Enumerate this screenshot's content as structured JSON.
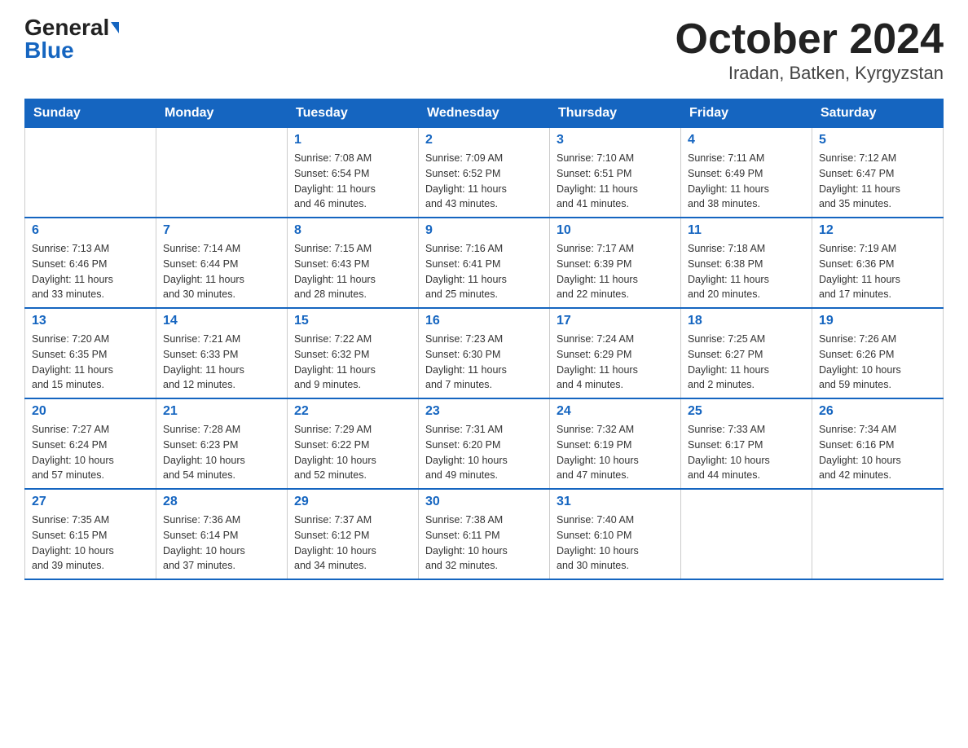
{
  "logo": {
    "general": "General",
    "blue": "Blue"
  },
  "title": "October 2024",
  "subtitle": "Iradan, Batken, Kyrgyzstan",
  "weekdays": [
    "Sunday",
    "Monday",
    "Tuesday",
    "Wednesday",
    "Thursday",
    "Friday",
    "Saturday"
  ],
  "weeks": [
    [
      {
        "day": "",
        "info": ""
      },
      {
        "day": "",
        "info": ""
      },
      {
        "day": "1",
        "info": "Sunrise: 7:08 AM\nSunset: 6:54 PM\nDaylight: 11 hours\nand 46 minutes."
      },
      {
        "day": "2",
        "info": "Sunrise: 7:09 AM\nSunset: 6:52 PM\nDaylight: 11 hours\nand 43 minutes."
      },
      {
        "day": "3",
        "info": "Sunrise: 7:10 AM\nSunset: 6:51 PM\nDaylight: 11 hours\nand 41 minutes."
      },
      {
        "day": "4",
        "info": "Sunrise: 7:11 AM\nSunset: 6:49 PM\nDaylight: 11 hours\nand 38 minutes."
      },
      {
        "day": "5",
        "info": "Sunrise: 7:12 AM\nSunset: 6:47 PM\nDaylight: 11 hours\nand 35 minutes."
      }
    ],
    [
      {
        "day": "6",
        "info": "Sunrise: 7:13 AM\nSunset: 6:46 PM\nDaylight: 11 hours\nand 33 minutes."
      },
      {
        "day": "7",
        "info": "Sunrise: 7:14 AM\nSunset: 6:44 PM\nDaylight: 11 hours\nand 30 minutes."
      },
      {
        "day": "8",
        "info": "Sunrise: 7:15 AM\nSunset: 6:43 PM\nDaylight: 11 hours\nand 28 minutes."
      },
      {
        "day": "9",
        "info": "Sunrise: 7:16 AM\nSunset: 6:41 PM\nDaylight: 11 hours\nand 25 minutes."
      },
      {
        "day": "10",
        "info": "Sunrise: 7:17 AM\nSunset: 6:39 PM\nDaylight: 11 hours\nand 22 minutes."
      },
      {
        "day": "11",
        "info": "Sunrise: 7:18 AM\nSunset: 6:38 PM\nDaylight: 11 hours\nand 20 minutes."
      },
      {
        "day": "12",
        "info": "Sunrise: 7:19 AM\nSunset: 6:36 PM\nDaylight: 11 hours\nand 17 minutes."
      }
    ],
    [
      {
        "day": "13",
        "info": "Sunrise: 7:20 AM\nSunset: 6:35 PM\nDaylight: 11 hours\nand 15 minutes."
      },
      {
        "day": "14",
        "info": "Sunrise: 7:21 AM\nSunset: 6:33 PM\nDaylight: 11 hours\nand 12 minutes."
      },
      {
        "day": "15",
        "info": "Sunrise: 7:22 AM\nSunset: 6:32 PM\nDaylight: 11 hours\nand 9 minutes."
      },
      {
        "day": "16",
        "info": "Sunrise: 7:23 AM\nSunset: 6:30 PM\nDaylight: 11 hours\nand 7 minutes."
      },
      {
        "day": "17",
        "info": "Sunrise: 7:24 AM\nSunset: 6:29 PM\nDaylight: 11 hours\nand 4 minutes."
      },
      {
        "day": "18",
        "info": "Sunrise: 7:25 AM\nSunset: 6:27 PM\nDaylight: 11 hours\nand 2 minutes."
      },
      {
        "day": "19",
        "info": "Sunrise: 7:26 AM\nSunset: 6:26 PM\nDaylight: 10 hours\nand 59 minutes."
      }
    ],
    [
      {
        "day": "20",
        "info": "Sunrise: 7:27 AM\nSunset: 6:24 PM\nDaylight: 10 hours\nand 57 minutes."
      },
      {
        "day": "21",
        "info": "Sunrise: 7:28 AM\nSunset: 6:23 PM\nDaylight: 10 hours\nand 54 minutes."
      },
      {
        "day": "22",
        "info": "Sunrise: 7:29 AM\nSunset: 6:22 PM\nDaylight: 10 hours\nand 52 minutes."
      },
      {
        "day": "23",
        "info": "Sunrise: 7:31 AM\nSunset: 6:20 PM\nDaylight: 10 hours\nand 49 minutes."
      },
      {
        "day": "24",
        "info": "Sunrise: 7:32 AM\nSunset: 6:19 PM\nDaylight: 10 hours\nand 47 minutes."
      },
      {
        "day": "25",
        "info": "Sunrise: 7:33 AM\nSunset: 6:17 PM\nDaylight: 10 hours\nand 44 minutes."
      },
      {
        "day": "26",
        "info": "Sunrise: 7:34 AM\nSunset: 6:16 PM\nDaylight: 10 hours\nand 42 minutes."
      }
    ],
    [
      {
        "day": "27",
        "info": "Sunrise: 7:35 AM\nSunset: 6:15 PM\nDaylight: 10 hours\nand 39 minutes."
      },
      {
        "day": "28",
        "info": "Sunrise: 7:36 AM\nSunset: 6:14 PM\nDaylight: 10 hours\nand 37 minutes."
      },
      {
        "day": "29",
        "info": "Sunrise: 7:37 AM\nSunset: 6:12 PM\nDaylight: 10 hours\nand 34 minutes."
      },
      {
        "day": "30",
        "info": "Sunrise: 7:38 AM\nSunset: 6:11 PM\nDaylight: 10 hours\nand 32 minutes."
      },
      {
        "day": "31",
        "info": "Sunrise: 7:40 AM\nSunset: 6:10 PM\nDaylight: 10 hours\nand 30 minutes."
      },
      {
        "day": "",
        "info": ""
      },
      {
        "day": "",
        "info": ""
      }
    ]
  ]
}
